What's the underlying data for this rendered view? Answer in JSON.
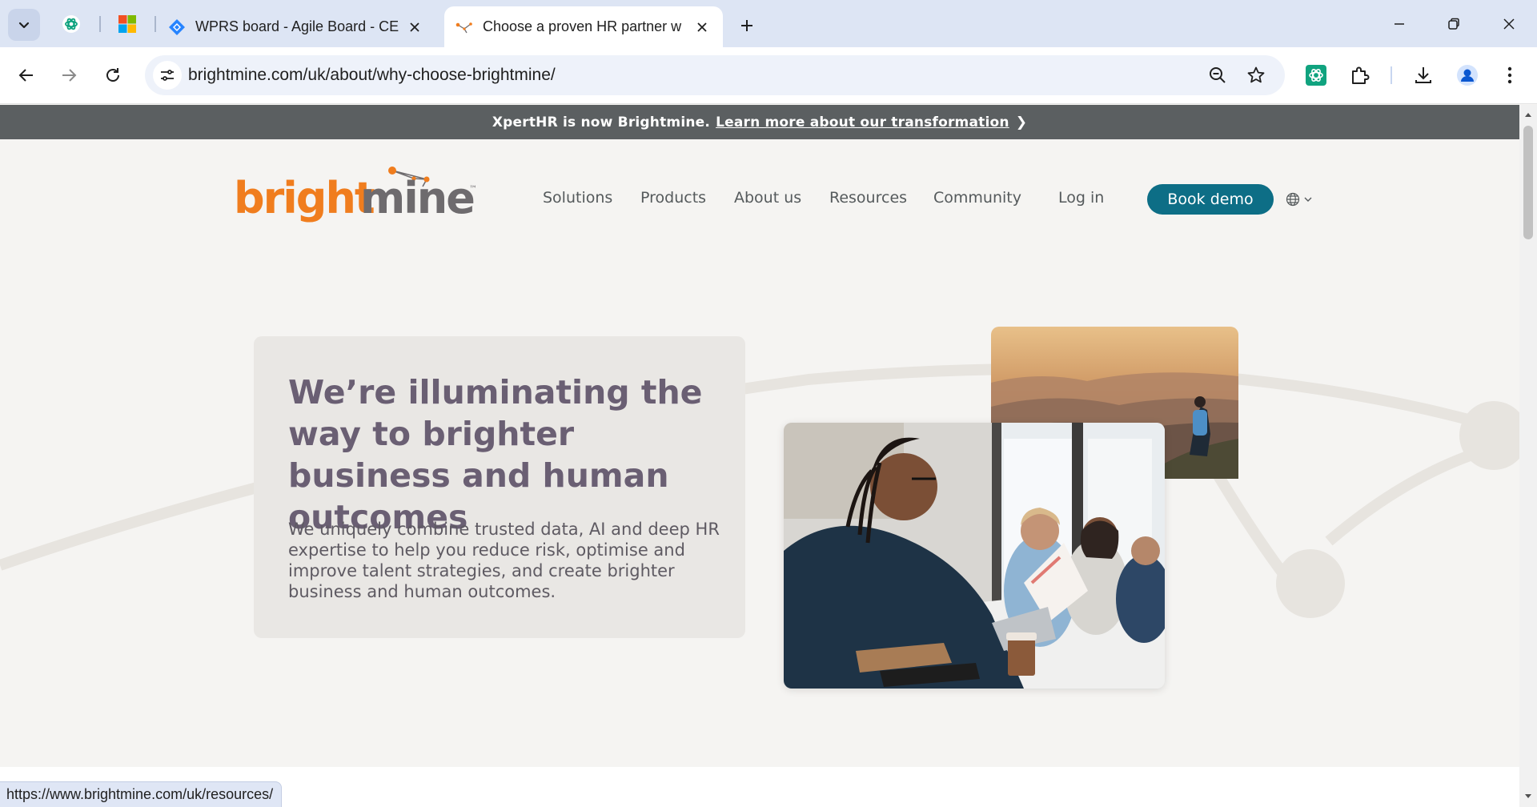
{
  "browser": {
    "tabs": [
      {
        "title": "WPRS board - Agile Board - CE",
        "active": false
      },
      {
        "title": "Choose a proven HR partner w",
        "active": true
      }
    ],
    "url": "brightmine.com/uk/about/why-choose-brightmine/",
    "status_url": "https://www.brightmine.com/uk/resources/"
  },
  "announcement": {
    "text": "XpertHR is now Brightmine.",
    "link": "Learn more about our transformation"
  },
  "header": {
    "logo_text_bright": "bright",
    "logo_text_mine": "mine",
    "logo_tm": "™",
    "nav": [
      "Solutions",
      "Products",
      "About us",
      "Resources",
      "Community"
    ],
    "login": "Log in",
    "cta": "Book demo"
  },
  "hero": {
    "title": "We’re illuminating the way to brighter business and human outcomes",
    "body": "We uniquely combine trusted data, AI and deep HR expertise to help you reduce risk, optimise and improve talent strategies, and create brighter business and human outcomes."
  },
  "colors": {
    "brand_orange": "#f07d1e",
    "brand_grey": "#6e6b6e",
    "cta_teal": "#0d6e86",
    "hero_title": "#6a5f73",
    "announce_bar": "#5b5f61"
  }
}
